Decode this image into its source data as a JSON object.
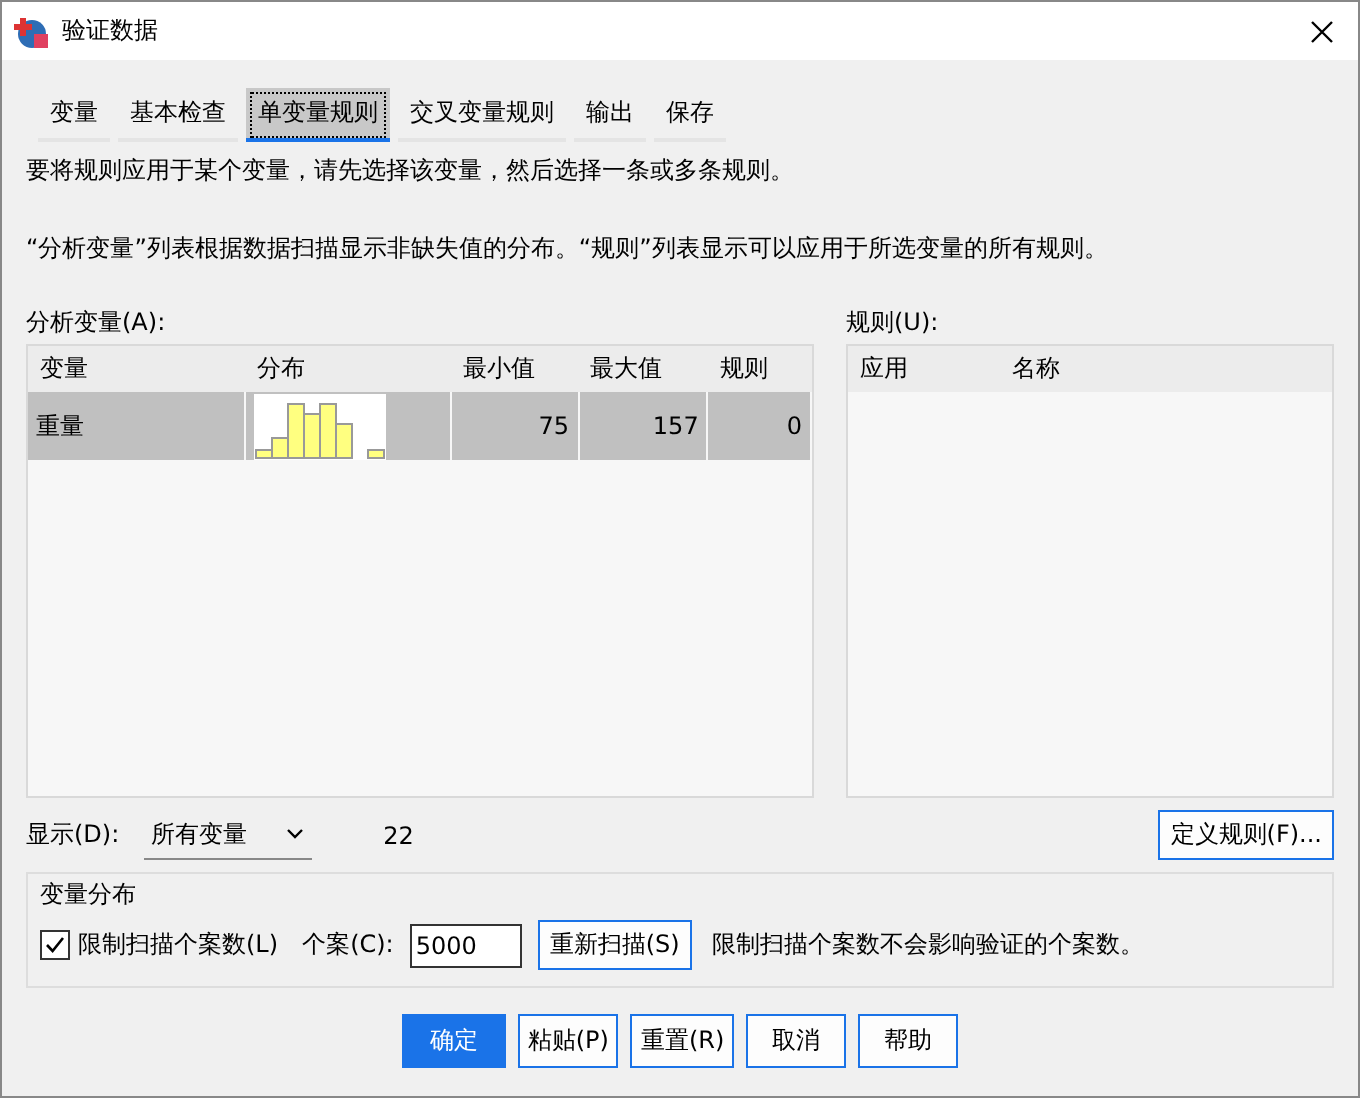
{
  "window": {
    "title": "验证数据"
  },
  "tabs": [
    {
      "label": "变量",
      "selected": false
    },
    {
      "label": "基本检查",
      "selected": false
    },
    {
      "label": "单变量规则",
      "selected": true
    },
    {
      "label": "交叉变量规则",
      "selected": false
    },
    {
      "label": "输出",
      "selected": false
    },
    {
      "label": "保存",
      "selected": false
    }
  ],
  "instructions": [
    "要将规则应用于某个变量，请先选择该变量，然后选择一条或多条规则。",
    "“分析变量”列表根据数据扫描显示非缺失值的分布。“规则”列表显示可以应用于所选变量的所有规则。"
  ],
  "variables_list": {
    "label": "分析变量(A):",
    "columns": [
      "变量",
      "分布",
      "最小值",
      "最大值",
      "规则"
    ],
    "rows": [
      {
        "name": "重量",
        "selected": true,
        "min": "75",
        "max": "157",
        "rules": "0"
      }
    ]
  },
  "rules_list": {
    "label": "规则(U):",
    "columns": [
      "应用",
      "名称"
    ]
  },
  "display": {
    "label": "显示(D):",
    "value": "所有变量",
    "count": "22"
  },
  "define_rules_button": "定义规则(F)...",
  "distribution_group": {
    "title": "变量分布",
    "limit_checkbox": {
      "label": "限制扫描个案数(L)",
      "checked": true
    },
    "cases_label": "个案(C):",
    "cases_value": "5000",
    "rescan_button": "重新扫描(S)",
    "note": "限制扫描个案数不会影响验证的个案数。"
  },
  "buttons": [
    {
      "label": "确定",
      "kind": "primary"
    },
    {
      "label": "粘贴(P)",
      "kind": "normal"
    },
    {
      "label": "重置(R)",
      "kind": "normal"
    },
    {
      "label": "取消",
      "kind": "normal"
    },
    {
      "label": "帮助",
      "kind": "normal"
    }
  ]
}
